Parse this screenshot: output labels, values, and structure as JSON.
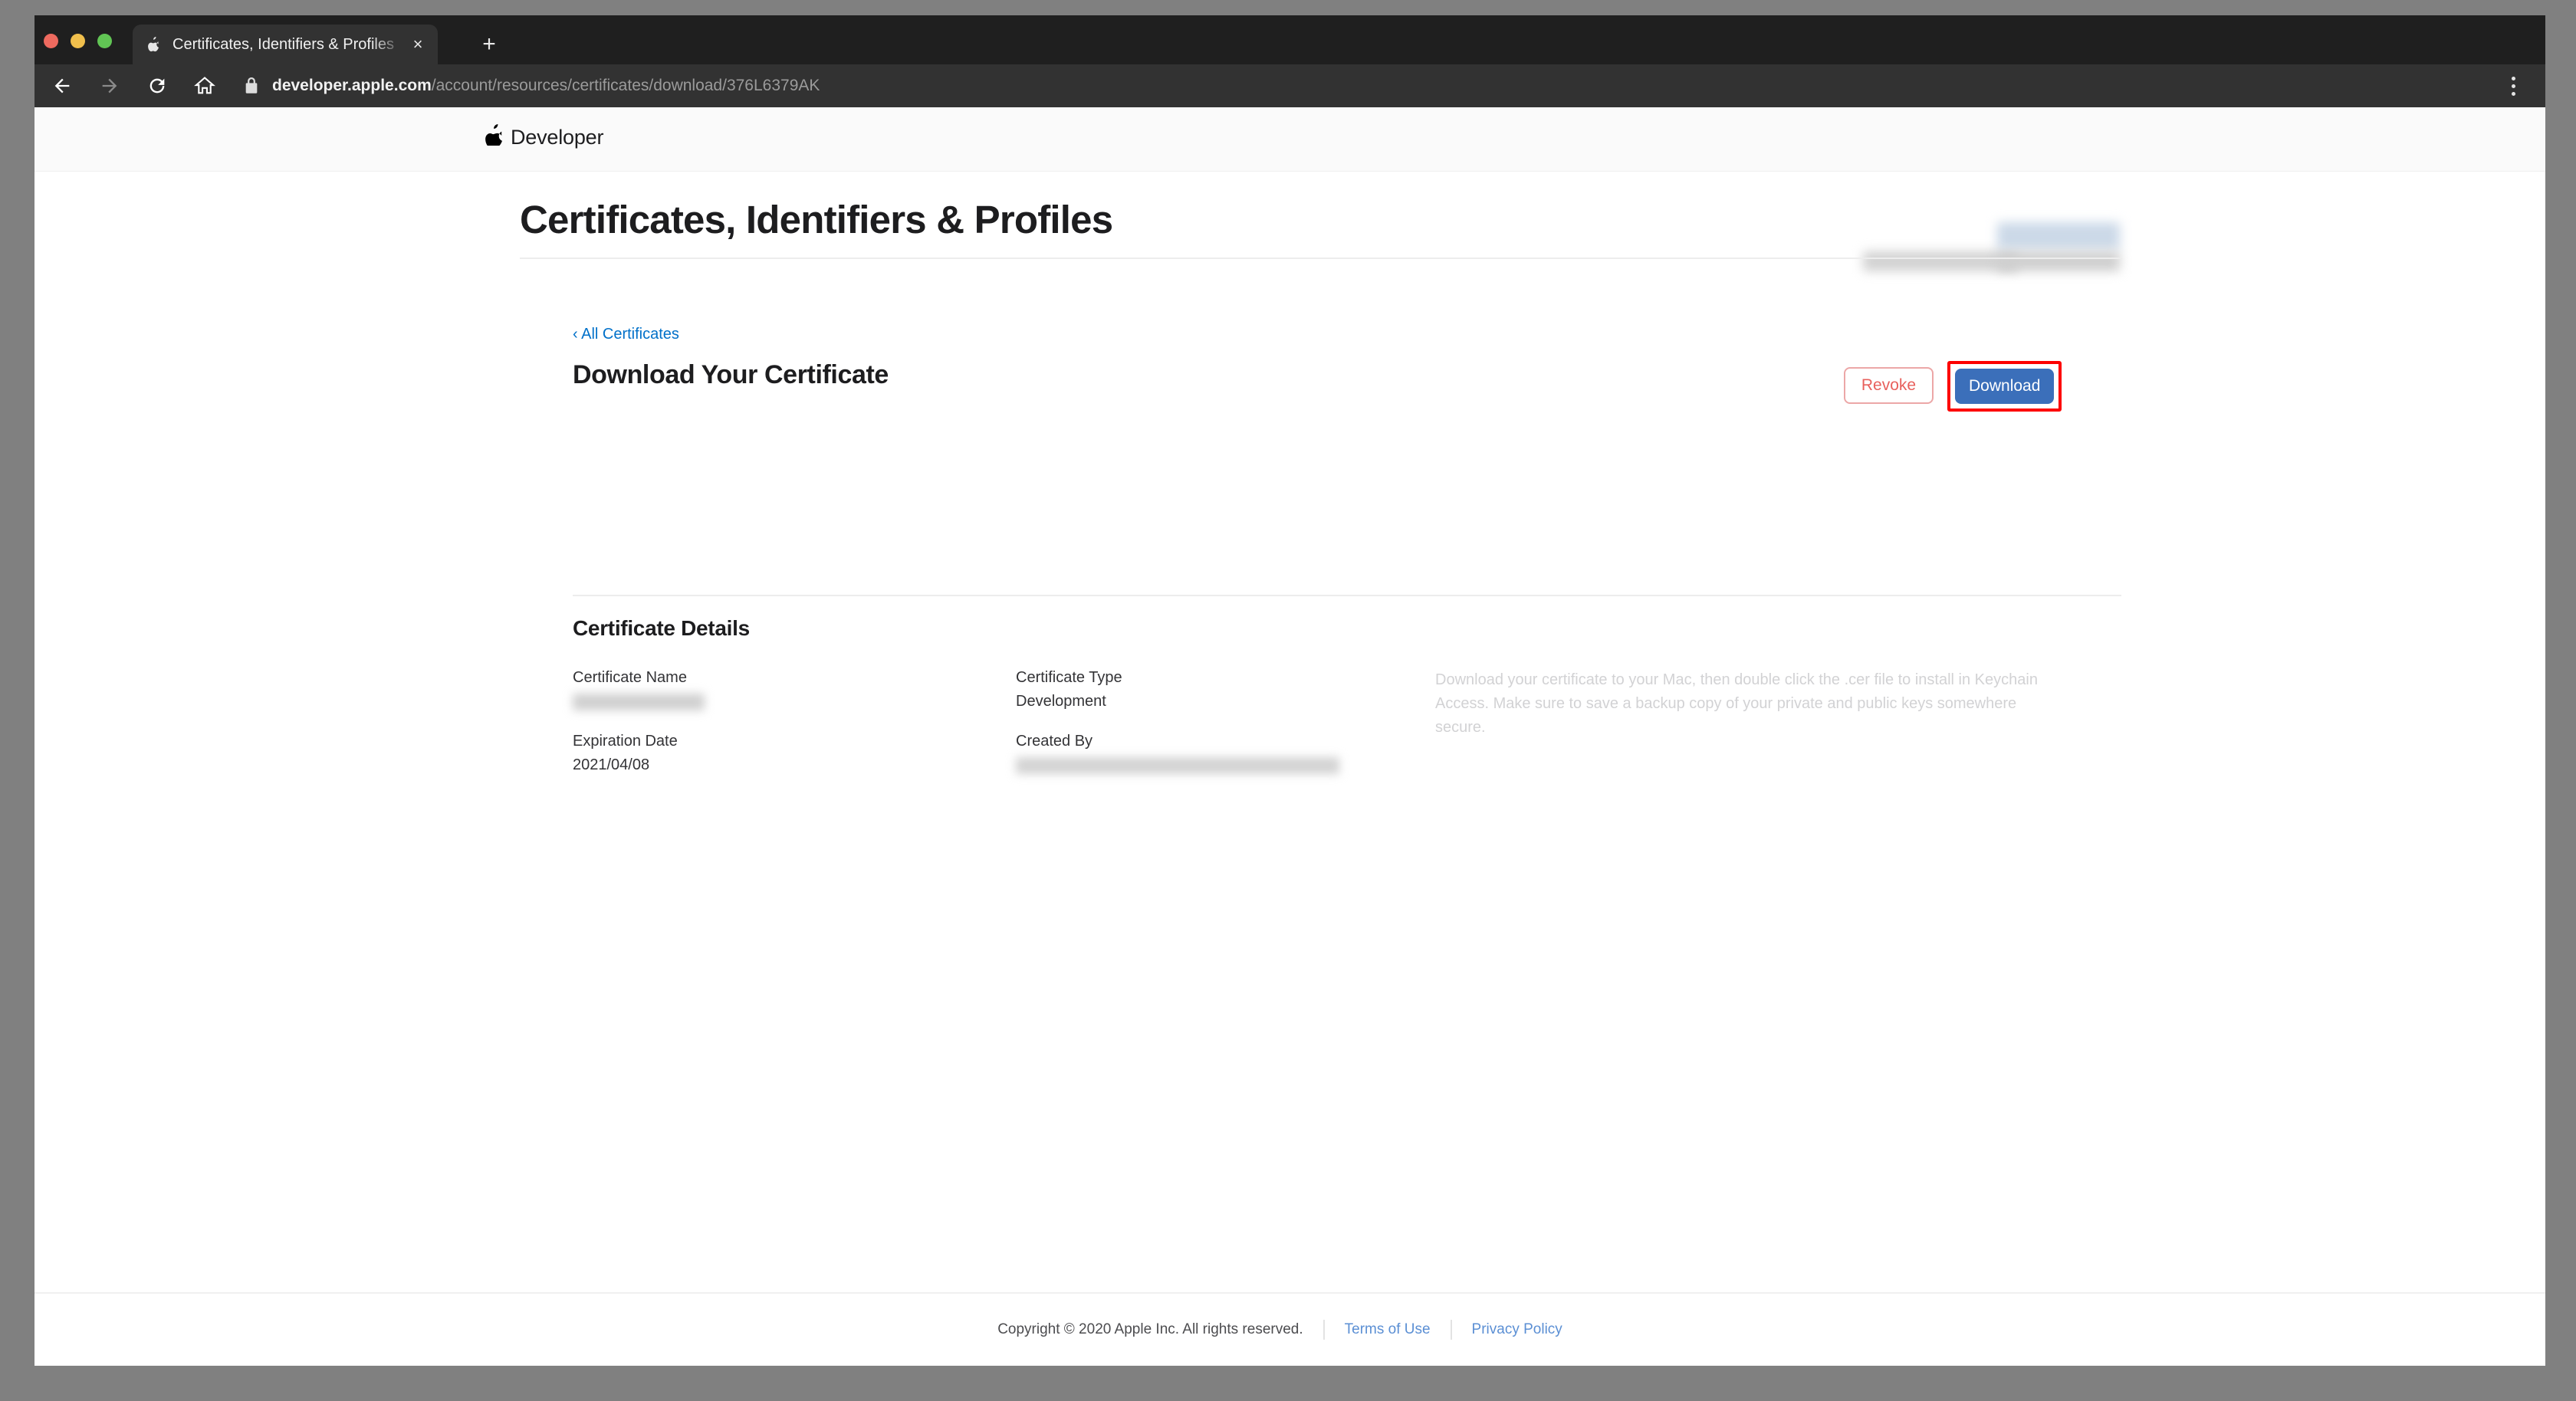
{
  "browser": {
    "window_controls": [
      "close",
      "minimize",
      "maximize"
    ],
    "tab": {
      "favicon": "apple-icon",
      "title": "Certificates, Identifiers & Profiles",
      "close_label": "×"
    },
    "new_tab_label": "+",
    "nav": {
      "back_label": "back-arrow-icon",
      "forward_label": "forward-arrow-icon",
      "reload_label": "reload-icon",
      "home_label": "home-icon"
    },
    "omnibox": {
      "secure_icon": "lock-icon",
      "url_host": "developer.apple.com",
      "url_path": "/account/resources/certificates/download/376L6379AK"
    },
    "menu_label": "more-vertical-icon"
  },
  "global_nav": {
    "apple_glyph": "",
    "wordmark": "Developer"
  },
  "page": {
    "title": "Certificates, Identifiers & Profiles",
    "breadcrumb": "‹ All Certificates",
    "section_title": "Download Your Certificate",
    "buttons": {
      "revoke_label": "Revoke",
      "download_label": "Download"
    },
    "details_title": "Certificate Details",
    "fields": [
      {
        "label": "Certificate Name",
        "value": "",
        "redacted": true
      },
      {
        "label": "Certificate Type",
        "value": "Development",
        "redacted": false
      },
      {
        "label": "Expiration Date",
        "value": "2021/04/08",
        "redacted": false
      },
      {
        "label": "Created By",
        "value": "",
        "redacted": true
      }
    ],
    "helper_text": "Download your certificate to your Mac, then double click the .cer file to install in Keychain Access. Make sure to save a backup copy of your private and public keys somewhere secure."
  },
  "footer": {
    "copyright": "Copyright © 2020 Apple Inc. All rights reserved.",
    "links": [
      "Terms of Use",
      "Privacy Policy"
    ]
  },
  "colors": {
    "accent_blue": "#3b6fba",
    "link_blue": "#0070c9",
    "revoke_red": "#e8605c",
    "highlight_red": "#fd0000",
    "chrome_dark": "#323232",
    "tabstrip_dark": "#1f1f1f",
    "desktop_gray": "#808080"
  }
}
